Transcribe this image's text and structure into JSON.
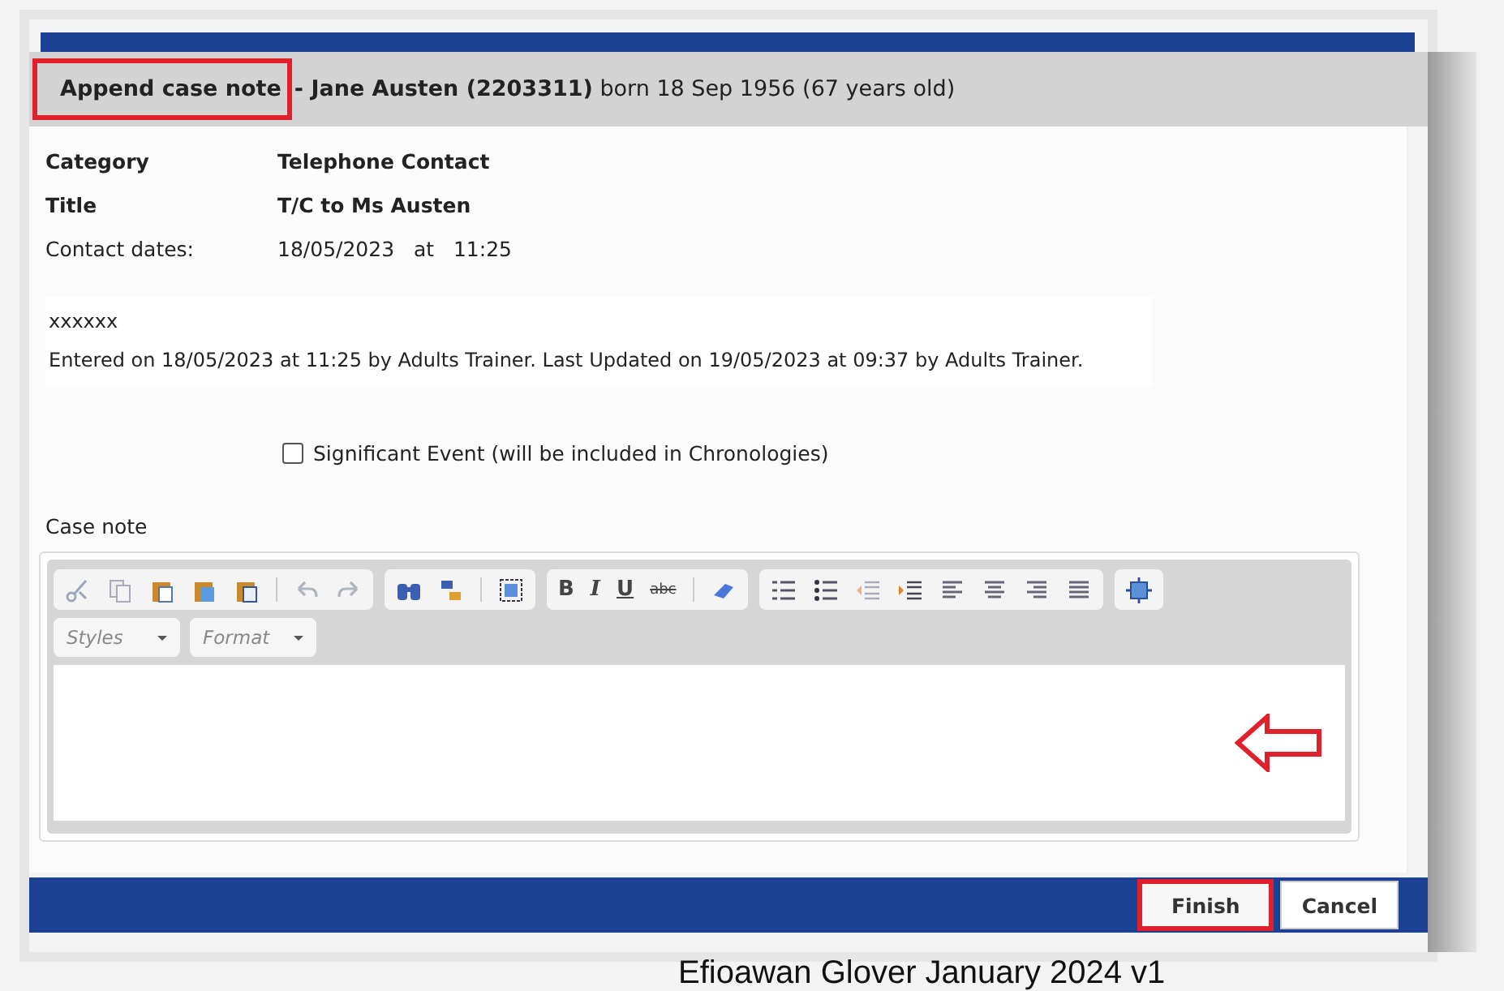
{
  "dialog": {
    "heading": "Append case note",
    "heading_highlighted": true,
    "subtitle": "**- Jane Austen (2203311)** born 18 Sep 1956 (67 years old)"
  },
  "details": [
    {
      "label": "Category",
      "value": "Telephone Contact",
      "bold": true
    },
    {
      "label": "Title",
      "value": "T/C to Ms Austen",
      "bold": true
    },
    {
      "label": "Contact dates:",
      "value": "18/05/2023   at   11:25",
      "bold": false
    }
  ],
  "existing_note": {
    "text": "xxxxxx",
    "meta": "Entered on 18/05/2023 at 11:25 by Adults Trainer. Last Updated on 19/05/2023 at 09:37 by Adults Trainer."
  },
  "significant_event": {
    "label": "Significant Event (will be included in Chronologies)",
    "checked": false
  },
  "case_note": {
    "label": "Case note",
    "format_buttons": [
      "B",
      "I",
      "U",
      "abc"
    ],
    "dropdowns": [
      {
        "placeholder": "Styles"
      },
      {
        "placeholder": "Format"
      }
    ],
    "annotation_arrow": true
  },
  "buttons": [
    {
      "label": "Finish",
      "highlighted": true
    },
    {
      "label": "Cancel",
      "highlighted": false
    }
  ],
  "footer": "Efioawan Glover  January 2024  v1"
}
